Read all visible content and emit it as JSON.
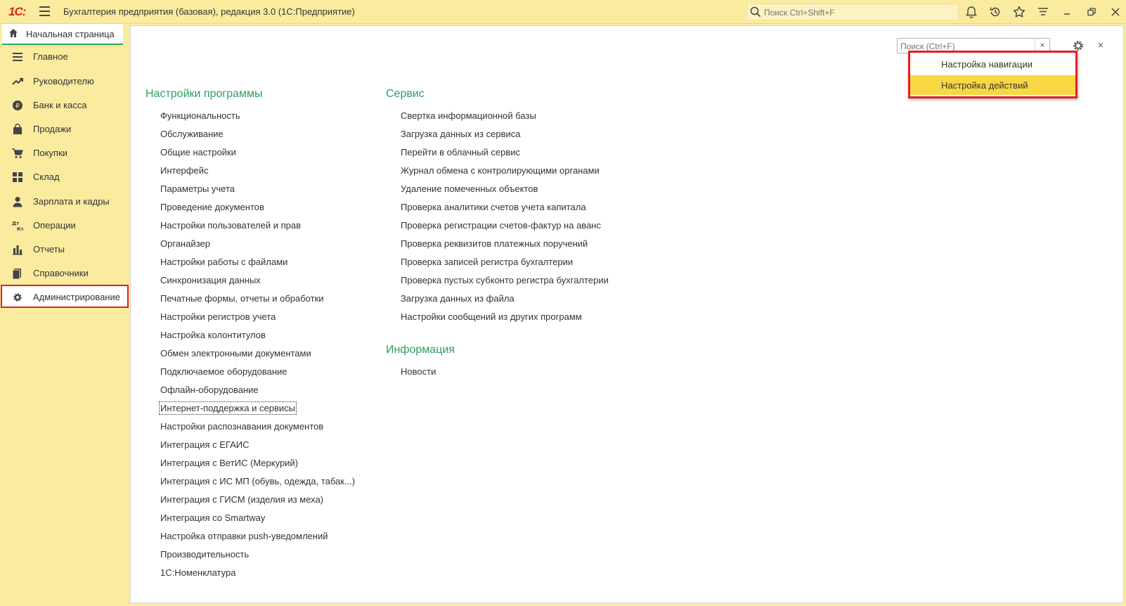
{
  "titlebar": {
    "logo": "1С:",
    "title": "Бухгалтерия предприятия (базовая), редакция 3.0  (1С:Предприятие)",
    "search_placeholder": "Поиск Ctrl+Shift+F"
  },
  "home_tab": {
    "label": "Начальная страница"
  },
  "sidebar": {
    "items": [
      {
        "label": "Главное",
        "icon": "menu-lines-icon"
      },
      {
        "label": "Руководителю",
        "icon": "trend-chart-icon"
      },
      {
        "label": "Банк и касса",
        "icon": "coin-icon"
      },
      {
        "label": "Продажи",
        "icon": "shopping-bag-icon"
      },
      {
        "label": "Покупки",
        "icon": "cart-icon"
      },
      {
        "label": "Склад",
        "icon": "warehouse-grid-icon"
      },
      {
        "label": "Зарплата и кадры",
        "icon": "person-icon"
      },
      {
        "label": "Операции",
        "icon": "dt-kt-icon"
      },
      {
        "label": "Отчеты",
        "icon": "bar-chart-icon"
      },
      {
        "label": "Справочники",
        "icon": "books-icon"
      },
      {
        "label": "Администрирование",
        "icon": "gear-icon"
      }
    ],
    "active_index": 10
  },
  "panel": {
    "search_placeholder": "Поиск (Ctrl+F)",
    "clear_label": "×",
    "close_label": "×"
  },
  "sections": {
    "settings": {
      "title": "Настройки программы",
      "links": [
        "Функциональность",
        "Обслуживание",
        "Общие настройки",
        "Интерфейс",
        "Параметры учета",
        "Проведение документов",
        "Настройки пользователей и прав",
        "Органайзер",
        "Настройки работы с файлами",
        "Синхронизация данных",
        "Печатные формы, отчеты и обработки",
        "Настройки регистров учета",
        "Настройка колонтитулов",
        "Обмен электронными документами",
        "Подключаемое оборудование",
        "Офлайн-оборудование",
        "Интернет-поддержка и сервисы",
        "Настройки распознавания документов",
        "Интеграция с ЕГАИС",
        "Интеграция с ВетИС (Меркурий)",
        "Интеграция с ИС МП (обувь, одежда, табак...)",
        "Интеграция с ГИСМ (изделия из меха)",
        "Интеграция со Smartway",
        "Настройка отправки push-уведомлений",
        "Производительность",
        "1С:Номенклатура"
      ]
    },
    "service": {
      "title": "Сервис",
      "links": [
        "Свертка информационной базы",
        "Загрузка данных из сервиса",
        "Перейти в облачный сервис",
        "Журнал обмена с контролирующими органами",
        "Удаление помеченных объектов",
        "Проверка аналитики счетов учета капитала",
        "Проверка регистрации счетов-фактур на аванс",
        "Проверка реквизитов платежных поручений",
        "Проверка записей регистра бухгалтерии",
        "Проверка пустых субконто регистра бухгалтерии",
        "Загрузка данных из файла",
        "Настройки сообщений из других программ"
      ]
    },
    "info": {
      "title": "Информация",
      "links": [
        "Новости"
      ]
    }
  },
  "dropdown": {
    "items": [
      "Настройка навигации",
      "Настройка действий"
    ],
    "highlighted_index": 1
  },
  "colors": {
    "accent_green": "#2d9e5f",
    "sidebar_bg": "#fbeb9f",
    "highlight_red": "#e41e26",
    "menu_highlight": "#f7d842"
  }
}
